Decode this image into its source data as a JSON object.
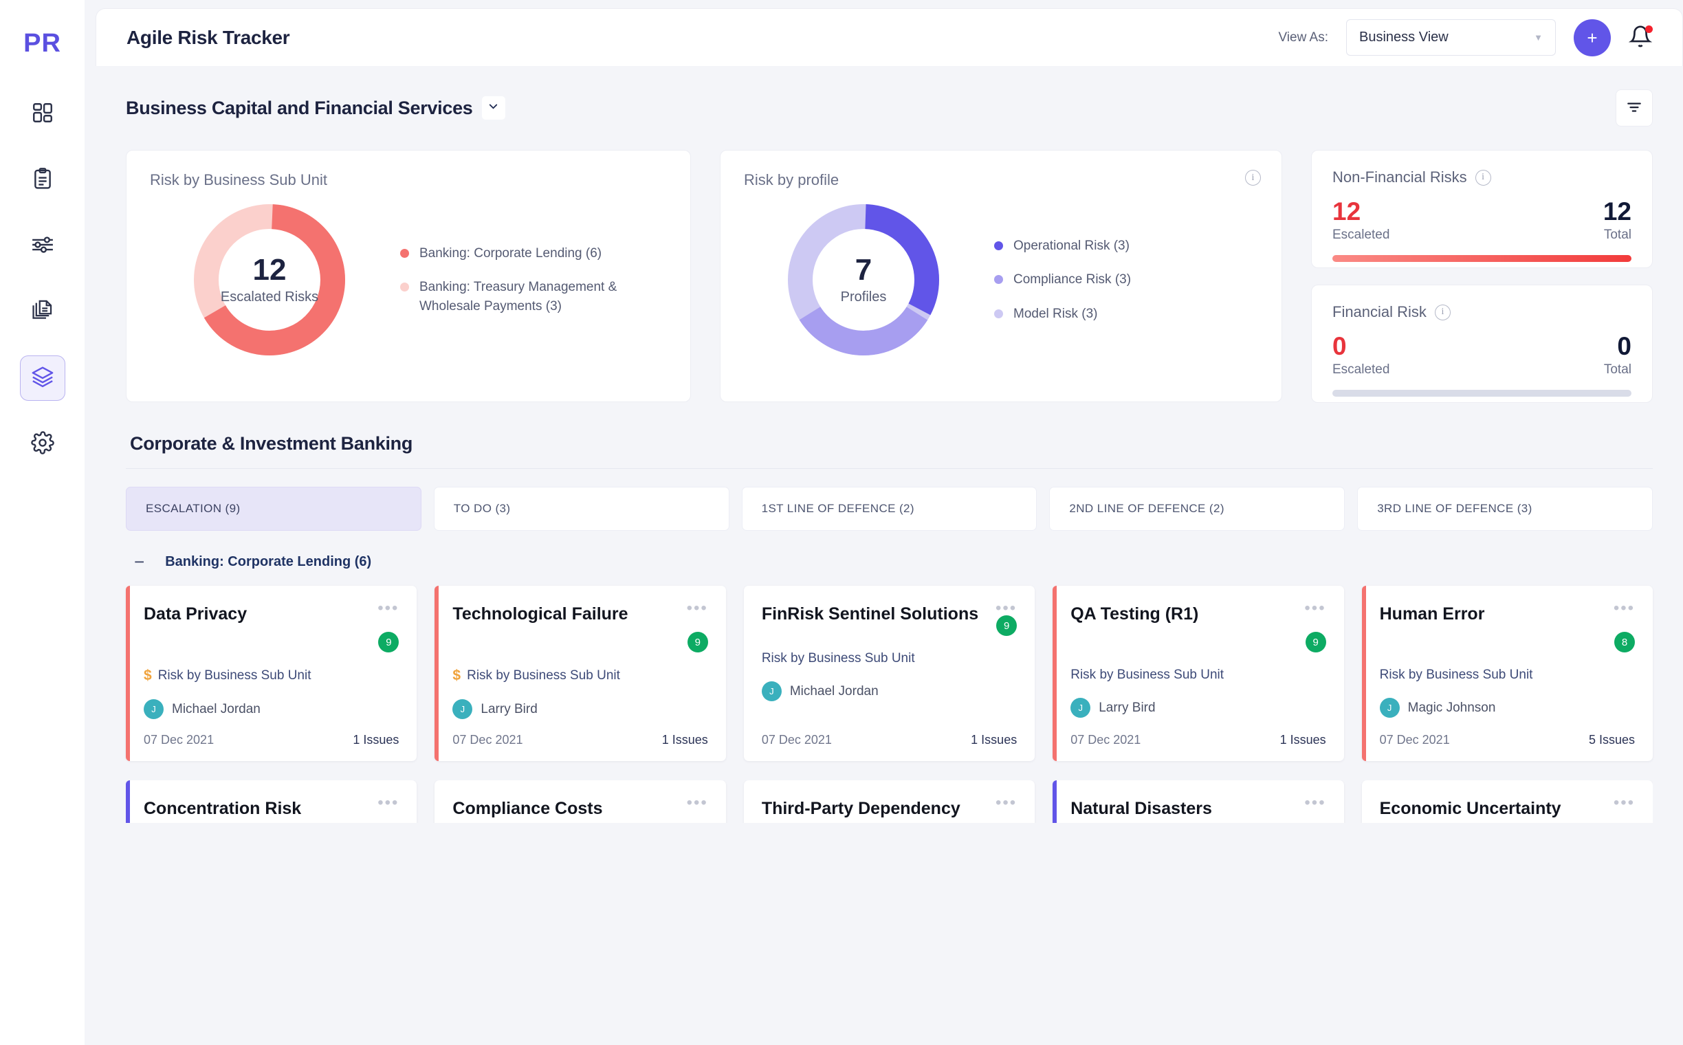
{
  "sidebar": {
    "logo": "PR",
    "items": [
      {
        "name": "dashboard",
        "icon": "grid-icon",
        "active": false
      },
      {
        "name": "tasks",
        "icon": "clipboard-icon",
        "active": false
      },
      {
        "name": "controls",
        "icon": "sliders-icon",
        "active": false
      },
      {
        "name": "documents",
        "icon": "documents-icon",
        "active": false
      },
      {
        "name": "registers",
        "icon": "layers-icon",
        "active": true
      },
      {
        "name": "settings",
        "icon": "gear-icon",
        "active": false
      }
    ]
  },
  "topbar": {
    "title": "Agile Risk Tracker",
    "view_as_label": "View As:",
    "view_select_value": "Business View",
    "add_button_label": "+",
    "notification_icon": "bell-icon",
    "has_notification": true
  },
  "section": {
    "title": "Business Capital and Financial Services",
    "collapse_icon": "chevron-down-icon",
    "filter_icon": "filter-icon"
  },
  "widgets": {
    "sub_unit": {
      "title": "Risk by Business Sub Unit",
      "center_value": "12",
      "center_label": "Escalated Risks"
    },
    "profile": {
      "title": "Risk by profile",
      "center_value": "7",
      "center_label": "Profiles",
      "info_icon": "info-icon"
    }
  },
  "kpis": [
    {
      "title": "Non-Financial  Risks",
      "info_icon": "info-icon",
      "escalated": "12",
      "escalated_label": "Escaleted",
      "total": "12",
      "total_label": "Total",
      "bar": "filled"
    },
    {
      "title": "Financial Risk",
      "info_icon": "info-icon",
      "escalated": "0",
      "escalated_label": "Escaleted",
      "total": "0",
      "total_label": "Total",
      "bar": "empty"
    }
  ],
  "board": {
    "title": "Corporate & Investment Banking",
    "tabs": [
      {
        "label": "ESCALATION (9)",
        "active": true
      },
      {
        "label": "TO DO (3)",
        "active": false
      },
      {
        "label": "1ST LINE OF DEFENCE (2)",
        "active": false
      },
      {
        "label": "2ND LINE OF DEFENCE (2)",
        "active": false
      },
      {
        "label": "3RD LINE OF DEFENCE (3)",
        "active": false
      }
    ],
    "group": {
      "toggle_icon": "minus-icon",
      "label": "Banking: Corporate Lending (6)"
    },
    "cards": [
      {
        "title": "Data Privacy",
        "badge": "9",
        "bar_color": "#f4726f",
        "has_dollar": true,
        "category": "Risk by Business Sub Unit",
        "owner": "Michael Jordan",
        "owner_initial": "J",
        "date": "07 Dec 2021",
        "issues": "1 Issues"
      },
      {
        "title": "Technological Failure",
        "badge": "9",
        "bar_color": "#f4726f",
        "has_dollar": true,
        "category": "Risk by Business Sub Unit",
        "owner": "Larry Bird",
        "owner_initial": "J",
        "date": "07 Dec 2021",
        "issues": "1 Issues"
      },
      {
        "title": "FinRisk Sentinel Solutions",
        "badge": "9",
        "bar_color": "",
        "has_dollar": false,
        "category": "Risk by Business Sub Unit",
        "owner": "Michael Jordan",
        "owner_initial": "J",
        "date": "07 Dec 2021",
        "issues": "1 Issues"
      },
      {
        "title": "QA Testing (R1)",
        "badge": "9",
        "bar_color": "#f4726f",
        "has_dollar": false,
        "category": "Risk by Business Sub Unit",
        "owner": "Larry Bird",
        "owner_initial": "J",
        "date": "07 Dec 2021",
        "issues": "1 Issues"
      },
      {
        "title": "Human Error",
        "badge": "8",
        "bar_color": "#f4726f",
        "has_dollar": false,
        "category": "Risk by Business Sub Unit",
        "owner": "Magic Johnson",
        "owner_initial": "J",
        "date": "07 Dec 2021",
        "issues": "5 Issues"
      }
    ],
    "cards_row2": [
      {
        "title": "Concentration Risk",
        "bar_color": "#6155e8"
      },
      {
        "title": "Compliance Costs",
        "bar_color": ""
      },
      {
        "title": "Third-Party Dependency",
        "bar_color": ""
      },
      {
        "title": "Natural Disasters",
        "bar_color": "#6155e8"
      },
      {
        "title": "Economic Uncertainty",
        "bar_color": ""
      }
    ]
  },
  "chart_data": [
    {
      "type": "pie",
      "title": "Risk by Business Sub Unit",
      "center_value": 12,
      "center_label": "Escalated Risks",
      "categories": [
        "Banking: Corporate Lending (6)",
        "Banking: Treasury Management & Wholesale Payments (3)"
      ],
      "values": [
        6,
        3
      ],
      "colors": [
        "#f4726f",
        "#fbd0cc"
      ],
      "legend_position": "right",
      "donut": true
    },
    {
      "type": "pie",
      "title": "Risk by profile",
      "center_value": 7,
      "center_label": "Profiles",
      "categories": [
        "Operational Risk (3)",
        "Compliance Risk (3)",
        "Model Risk (3)"
      ],
      "values": [
        3,
        3,
        3
      ],
      "colors": [
        "#6155e8",
        "#a79ef0",
        "#cdc9f3"
      ],
      "legend_position": "right",
      "donut": true
    },
    {
      "type": "bar",
      "title": "Non-Financial  Risks",
      "categories": [
        "Escaleted",
        "Total"
      ],
      "values": [
        12,
        12
      ],
      "ylim": [
        0,
        12
      ]
    },
    {
      "type": "bar",
      "title": "Financial Risk",
      "categories": [
        "Escaleted",
        "Total"
      ],
      "values": [
        0,
        0
      ],
      "ylim": [
        0,
        12
      ]
    }
  ]
}
